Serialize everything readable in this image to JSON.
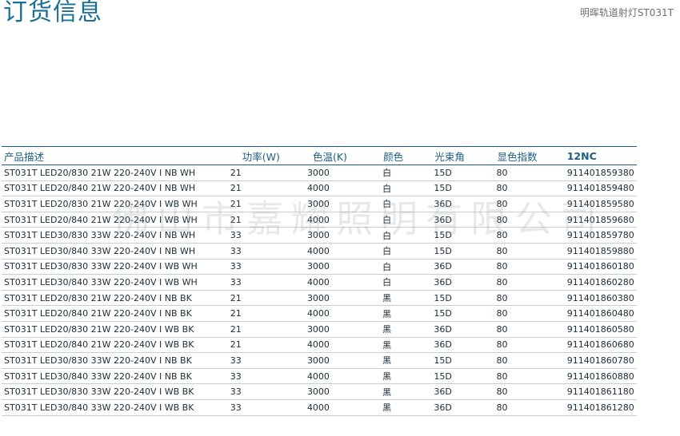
{
  "header": {
    "title": "订货信息",
    "subtitle": "明晖轨道射灯ST031T"
  },
  "watermark": "佛山市嘉耀照明有限公司",
  "table": {
    "columns": [
      "产品描述",
      "功率(W)",
      "色温(K)",
      "颜色",
      "光束角",
      "显色指数",
      "12NC"
    ],
    "rows": [
      [
        "ST031T LED20/830 21W 220-240V I NB WH",
        "21",
        "3000",
        "白",
        "15D",
        "80",
        "911401859380"
      ],
      [
        "ST031T LED20/840 21W 220-240V I NB WH",
        "21",
        "4000",
        "白",
        "15D",
        "80",
        "911401859480"
      ],
      [
        "ST031T LED20/830 21W 220-240V I WB WH",
        "21",
        "3000",
        "白",
        "36D",
        "80",
        "911401859580"
      ],
      [
        "ST031T LED20/840 21W 220-240V I WB WH",
        "21",
        "4000",
        "白",
        "36D",
        "80",
        "911401859680"
      ],
      [
        "ST031T LED30/830 33W 220-240V I NB WH",
        "33",
        "3000",
        "白",
        "15D",
        "80",
        "911401859780"
      ],
      [
        "ST031T LED30/840 33W 220-240V I NB WH",
        "33",
        "4000",
        "白",
        "15D",
        "80",
        "911401859880"
      ],
      [
        "ST031T LED30/830 33W 220-240V I WB WH",
        "33",
        "3000",
        "白",
        "36D",
        "80",
        "911401860180"
      ],
      [
        "ST031T LED30/840 33W 220-240V I WB WH",
        "33",
        "4000",
        "白",
        "36D",
        "80",
        "911401860280"
      ],
      [
        "ST031T LED20/830 21W 220-240V I NB BK",
        "21",
        "3000",
        "黑",
        "15D",
        "80",
        "911401860380"
      ],
      [
        "ST031T LED20/840 21W 220-240V I NB BK",
        "21",
        "4000",
        "黑",
        "15D",
        "80",
        "911401860480"
      ],
      [
        "ST031T LED20/830 21W 220-240V I WB BK",
        "21",
        "3000",
        "黑",
        "36D",
        "80",
        "911401860580"
      ],
      [
        "ST031T LED20/840 21W 220-240V I WB BK",
        "21",
        "4000",
        "黑",
        "36D",
        "80",
        "911401860680"
      ],
      [
        "ST031T LED30/830 33W 220-240V I NB BK",
        "33",
        "3000",
        "黑",
        "15D",
        "80",
        "911401860780"
      ],
      [
        "ST031T LED30/840 33W 220-240V I NB BK",
        "33",
        "4000",
        "黑",
        "15D",
        "80",
        "911401860880"
      ],
      [
        "ST031T LED30/830 33W 220-240V I WB BK",
        "33",
        "3000",
        "黑",
        "36D",
        "80",
        "911401861180"
      ],
      [
        "ST031T LED30/840 33W 220-240V I WB BK",
        "33",
        "4000",
        "黑",
        "36D",
        "80",
        "911401861280"
      ]
    ]
  },
  "colors": {
    "accent": "#1a6f94",
    "header_rule": "#1b5f80",
    "row_rule": "#c9ced3"
  }
}
